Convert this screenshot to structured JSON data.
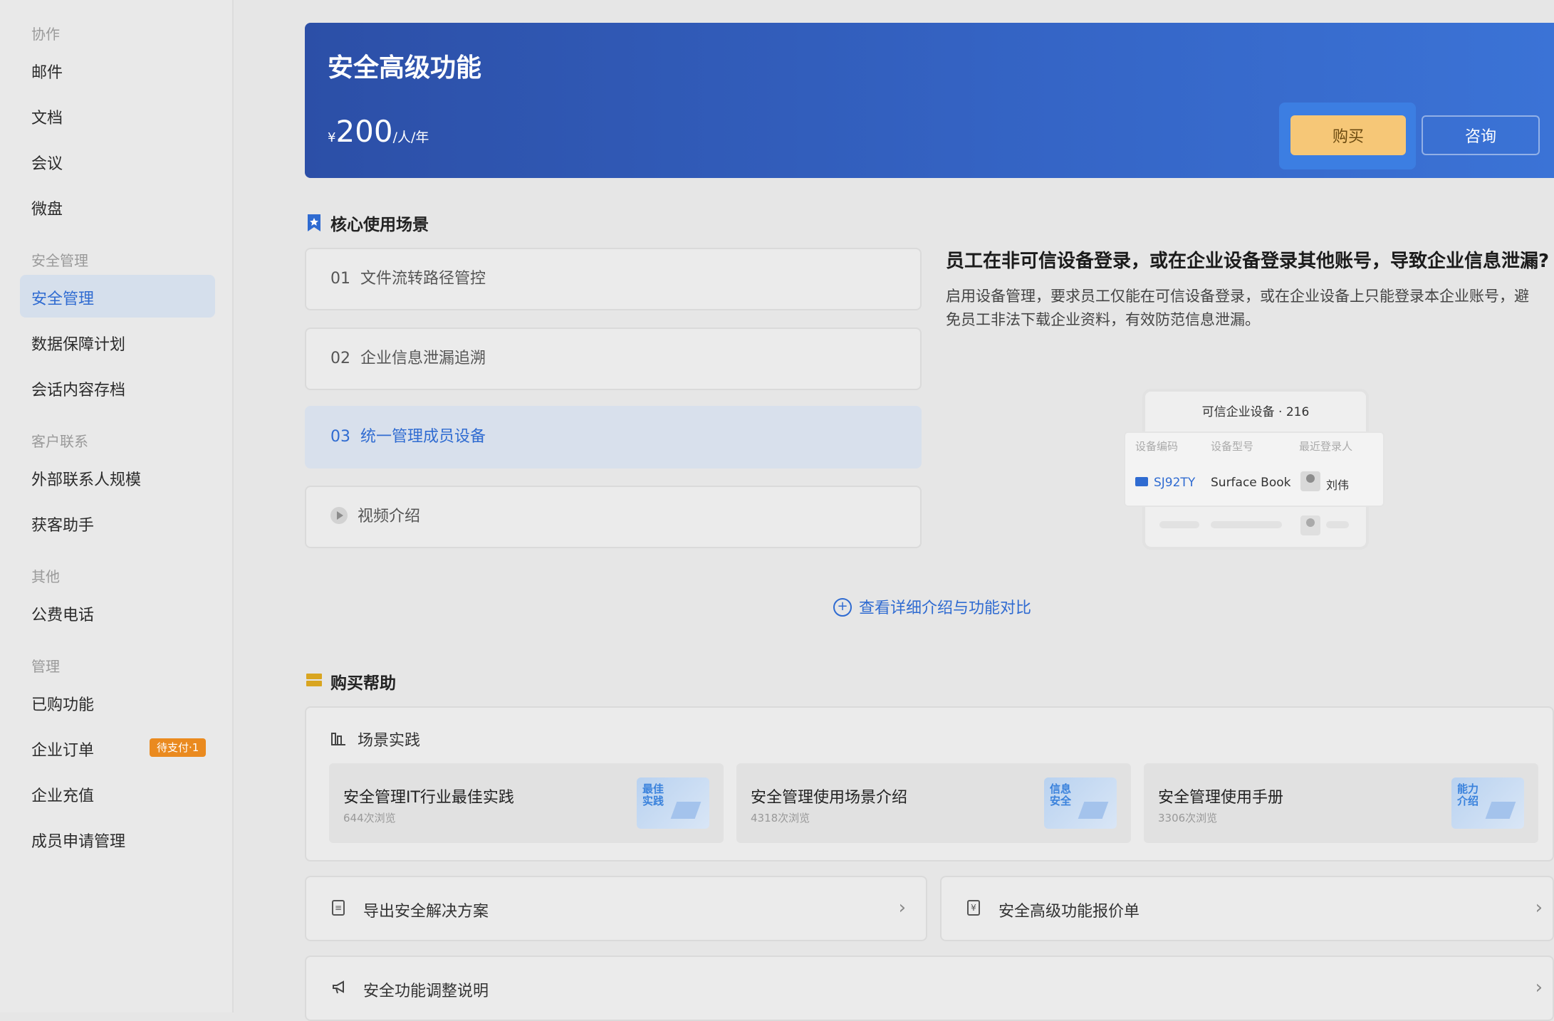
{
  "sidebar": {
    "groups": {
      "collab": "协作",
      "security": "安全管理",
      "customer": "客户联系",
      "other": "其他",
      "manage": "管理"
    },
    "items": {
      "mail": "邮件",
      "docs": "文档",
      "meeting": "会议",
      "drive": "微盘",
      "security": "安全管理",
      "data_plan": "数据保障计划",
      "archive": "会话内容存档",
      "external": "外部联系人规模",
      "acquire": "获客助手",
      "phone": "公费电话",
      "purchased": "已购功能",
      "orders": "企业订单",
      "recharge": "企业充值",
      "member_apply": "成员申请管理"
    },
    "order_badge": "待支付·1"
  },
  "banner": {
    "title": "安全高级功能",
    "currency": "¥",
    "price": "200",
    "unit": "/人/年",
    "buy_label": "购买",
    "consult_label": "咨询"
  },
  "scenarios": {
    "title": "核心使用场景",
    "items": [
      {
        "num": "01",
        "label": "文件流转路径管控"
      },
      {
        "num": "02",
        "label": "企业信息泄漏追溯"
      },
      {
        "num": "03",
        "label": "统一管理成员设备"
      }
    ],
    "video_label": "视频介绍"
  },
  "detail": {
    "title": "员工在非可信设备登录，或在企业设备登录其他账号，导致企业信息泄漏?",
    "text": "启用设备管理，要求员工仅能在可信设备登录，或在企业设备上只能登录本企业账号，避免员工非法下载企业资料，有效防范信息泄漏。",
    "illustration": {
      "title": "可信企业设备 · 216",
      "headers": [
        "设备编码",
        "设备型号",
        "最近登录人"
      ],
      "row": {
        "code": "SJ92TY",
        "model": "Surface Book",
        "user": "刘伟"
      }
    },
    "more_link": "查看详细介绍与功能对比"
  },
  "help": {
    "title": "购买帮助",
    "practice_title": "场景实践",
    "practices": [
      {
        "title": "安全管理IT行业最佳实践",
        "views": "644次浏览",
        "tag": "最佳实践"
      },
      {
        "title": "安全管理使用场景介绍",
        "views": "4318次浏览",
        "tag": "信息安全"
      },
      {
        "title": "安全管理使用手册",
        "views": "3306次浏览",
        "tag": "能力介绍"
      }
    ],
    "export_label": "导出安全解决方案",
    "quote_label": "安全高级功能报价单",
    "adjust_label": "安全功能调整说明"
  },
  "colors": {
    "accent": "#2f6bd1",
    "banner_start": "#2c4fa7",
    "banner_end": "#3b73d6",
    "buy": "#f6c777",
    "badge": "#ea8a1f"
  }
}
